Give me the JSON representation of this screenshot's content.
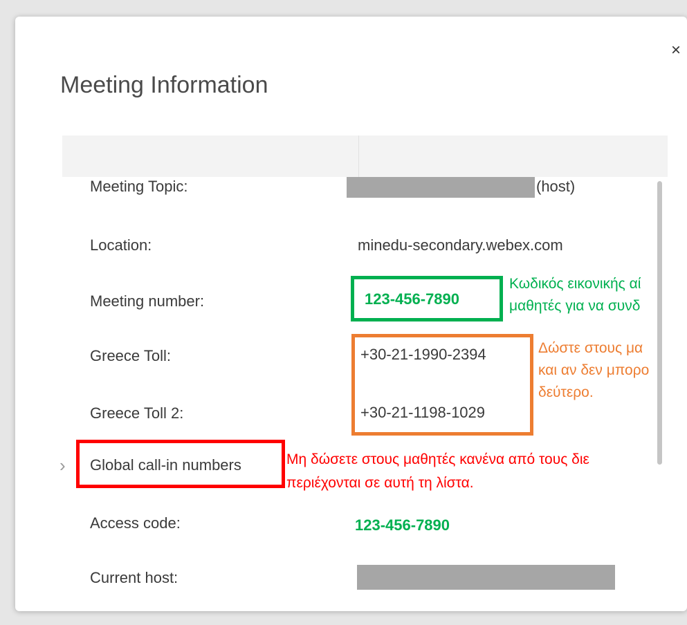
{
  "dialog": {
    "title": "Meeting Information",
    "close_glyph": "×"
  },
  "fields": {
    "topic": {
      "label": "Meeting Topic:",
      "suffix": "(host)"
    },
    "location": {
      "label": "Location:",
      "value": "minedu-secondary.webex.com"
    },
    "meeting_number": {
      "label": "Meeting number:",
      "value": "123-456-7890"
    },
    "toll1": {
      "label": "Greece Toll:",
      "value": "+30-21-1990-2394"
    },
    "toll2": {
      "label": "Greece Toll 2:",
      "value": "+30-21-1198-1029"
    },
    "global": {
      "label": "Global call-in numbers",
      "chevron": "›"
    },
    "access_code": {
      "label": "Access code:",
      "value": "123-456-7890"
    },
    "current_host": {
      "label": "Current host:"
    }
  },
  "annotations": {
    "green": [
      "Κωδικός εικονικής αί",
      "μαθητές για να συνδ"
    ],
    "orange": [
      "Δώστε στους μα",
      "και αν δεν μπορο",
      "δεύτερο."
    ],
    "red": [
      "Μη δώσετε στους μαθητές κανένα από τους διε",
      "περιέχονται σε αυτή τη λίστα."
    ]
  },
  "colors": {
    "green": "#00b050",
    "orange": "#ed7d31",
    "red": "#ff0000",
    "redaction": "#a6a6a6"
  }
}
